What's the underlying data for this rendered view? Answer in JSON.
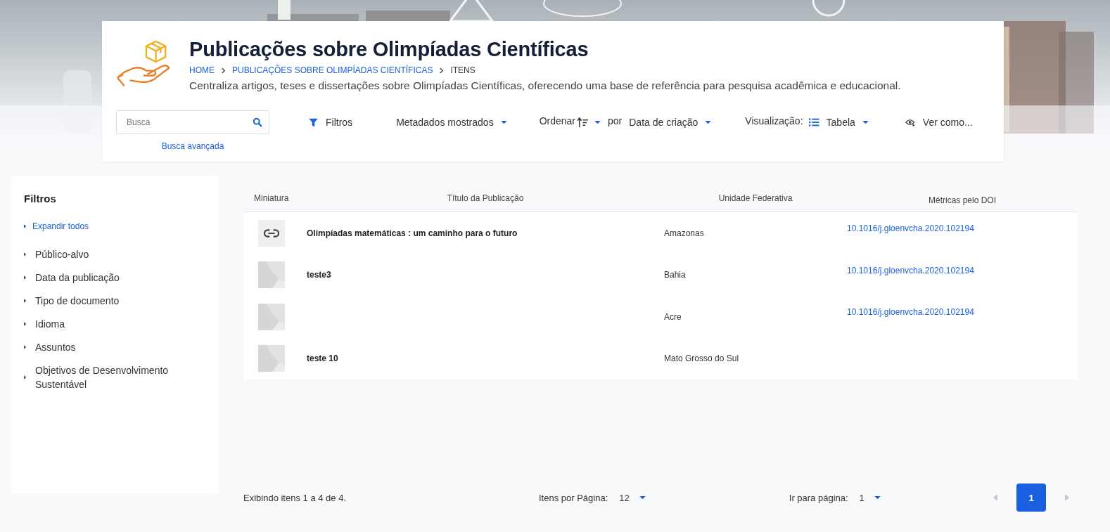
{
  "header": {
    "title": "Publicações sobre Olimpíadas Científicas",
    "breadcrumb": [
      {
        "label": "HOME",
        "link": true
      },
      {
        "label": "PUBLICAÇÕES SOBRE OLIMPÍADAS CIENTÍFICAS",
        "link": true
      },
      {
        "label": "ITENS",
        "link": false
      }
    ],
    "description": "Centraliza artigos, teses e dissertações sobre Olimpíadas Científicas, oferecendo uma base de referência para pesquisa acadêmica e educacional."
  },
  "search": {
    "placeholder": "Busca",
    "advanced_link": "Busca avançada"
  },
  "toolbar": {
    "filters_button": "Filtros",
    "metadata_dropdown": "Metadados mostrados",
    "sort_label": "Ordenar",
    "sort_by_label": "por",
    "sort_field": "Data de criação",
    "view_label": "Visualização:",
    "view_mode": "Tabela",
    "view_as": "Ver como..."
  },
  "filters_panel": {
    "title": "Filtros",
    "expand_all": "Expandir todos",
    "items": [
      {
        "label": "Público-alvo",
        "expanded": false
      },
      {
        "label": "Data da publicação",
        "expanded": false
      },
      {
        "label": "Tipo de documento",
        "expanded": false
      },
      {
        "label": "Idioma",
        "expanded": false
      },
      {
        "label": "Assuntos",
        "expanded": false
      },
      {
        "label": "Objetivos de Desenvolvimento Sustentável",
        "expanded": false
      }
    ]
  },
  "table": {
    "columns": [
      "Miniatura",
      "Título da Publicação",
      "Unidade Federativa",
      "Métricas pelo DOI"
    ],
    "rows": [
      {
        "thumbnail": {
          "kind": "link"
        },
        "title": "Olimpíadas matemáticas : um caminho para o futuro",
        "state": "Amazonas",
        "doi": "10.1016/j.gloenvcha.2020.102194"
      },
      {
        "thumbnail": {
          "kind": "placeholder"
        },
        "title": "teste3",
        "state": "Bahia",
        "doi": "10.1016/j.gloenvcha.2020.102194"
      },
      {
        "thumbnail": {
          "kind": "placeholder"
        },
        "state": "Acre",
        "doi": "10.1016/j.gloenvcha.2020.102194"
      },
      {
        "thumbnail": {
          "kind": "placeholder"
        },
        "title": "teste 10",
        "state": "Mato Grosso do Sul"
      }
    ]
  },
  "footer": {
    "showing": "Exibindo itens 1 a 4 de 4.",
    "per_page_label": "Itens por Página:",
    "per_page": "12",
    "goto_label": "Ir para página:",
    "goto_page": "1",
    "prev": {
      "disabled": true
    },
    "pages": [
      {
        "label": "1",
        "selected": true
      }
    ],
    "next": {
      "disabled": true
    }
  }
}
